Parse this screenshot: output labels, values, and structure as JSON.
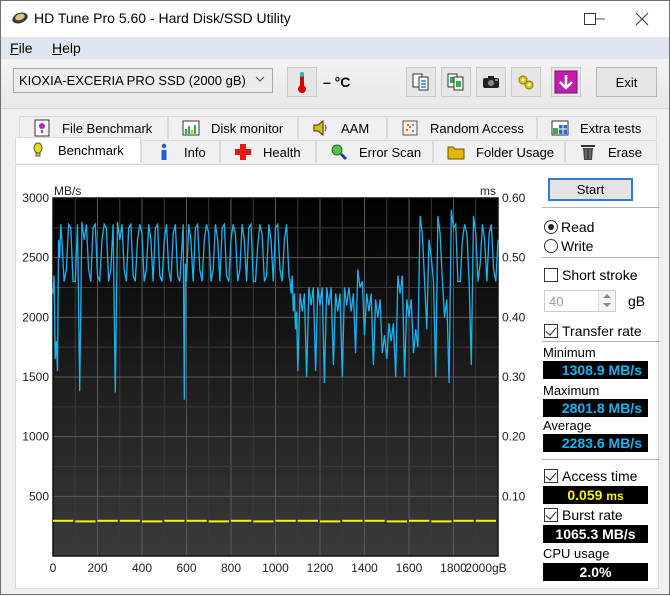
{
  "window": {
    "title": "HD Tune Pro 5.60 - Hard Disk/SSD Utility",
    "controls": [
      "minimize",
      "maximize",
      "close"
    ]
  },
  "menu": {
    "items": [
      {
        "label": "File",
        "accel": "F",
        "rest": "ile"
      },
      {
        "label": "Help",
        "accel": "H",
        "rest": "elp"
      }
    ]
  },
  "toolbar": {
    "drive": "KIOXIA-EXCERIA PRO SSD (2000 gB)",
    "temperature": "– °C",
    "icons": [
      "copy-text-icon",
      "copy-screenshot-icon",
      "camera-icon",
      "options-icon",
      "save-download-icon"
    ],
    "exit_label": "Exit"
  },
  "tabs": {
    "row1": [
      {
        "label": "File Benchmark",
        "icon": "file-benchmark-icon"
      },
      {
        "label": "Disk monitor",
        "icon": "disk-monitor-icon"
      },
      {
        "label": "AAM",
        "icon": "speaker-icon"
      },
      {
        "label": "Random Access",
        "icon": "random-access-icon"
      },
      {
        "label": "Extra tests",
        "icon": "extra-tests-icon"
      }
    ],
    "row2": [
      {
        "label": "Benchmark",
        "icon": "benchmark-icon",
        "active": true
      },
      {
        "label": "Info",
        "icon": "info-icon"
      },
      {
        "label": "Health",
        "icon": "health-icon"
      },
      {
        "label": "Error Scan",
        "icon": "error-scan-icon"
      },
      {
        "label": "Folder Usage",
        "icon": "folder-icon"
      },
      {
        "label": "Erase",
        "icon": "trash-icon"
      }
    ]
  },
  "side": {
    "start_label": "Start",
    "mode": {
      "read_label": "Read",
      "write_label": "Write",
      "selected": "read"
    },
    "short_stroke": {
      "label": "Short stroke",
      "checked": false,
      "value": "40",
      "unit": "gB"
    },
    "transfer_rate": {
      "label": "Transfer rate",
      "checked": true
    },
    "minimum": {
      "label": "Minimum",
      "value": "1308.9 MB/s"
    },
    "maximum": {
      "label": "Maximum",
      "value": "2801.8 MB/s"
    },
    "average": {
      "label": "Average",
      "value": "2283.6 MB/s"
    },
    "access_time": {
      "label": "Access time",
      "checked": true,
      "value": "0.059",
      "unit": "ms"
    },
    "burst_rate": {
      "label": "Burst rate",
      "checked": true,
      "value": "1065.3 MB/s"
    },
    "cpu": {
      "label": "CPU usage",
      "value": "2.0%"
    }
  },
  "chart_data": {
    "type": "line",
    "title": "",
    "xlabel": "gB",
    "ylabel": "MB/s",
    "y2label": "ms",
    "xlim": [
      0,
      2000
    ],
    "ylim": [
      0,
      3000
    ],
    "y2lim": [
      0,
      0.6
    ],
    "x_ticks": [
      "0",
      "200",
      "400",
      "600",
      "800",
      "1000",
      "1200",
      "1400",
      "1600",
      "1800",
      "2000gB"
    ],
    "y_ticks": [
      "500",
      "1000",
      "1500",
      "2000",
      "2500",
      "3000"
    ],
    "y2_ticks": [
      "0.10",
      "0.20",
      "0.30",
      "0.40",
      "0.50",
      "0.60"
    ],
    "grid": true,
    "series": [
      {
        "name": "Transfer rate",
        "color": "#1ab3f0",
        "axis": "left",
        "x": [
          0,
          10,
          20,
          30,
          40,
          60,
          80,
          100,
          120,
          140,
          160,
          180,
          200,
          220,
          240,
          260,
          280,
          300,
          320,
          340,
          360,
          380,
          400,
          420,
          440,
          460,
          480,
          500,
          520,
          540,
          560,
          580,
          590,
          600,
          620,
          640,
          660,
          680,
          700,
          720,
          740,
          760,
          780,
          800,
          820,
          840,
          860,
          880,
          900,
          920,
          940,
          960,
          980,
          1000,
          1020,
          1040,
          1060,
          1070,
          1080,
          1090,
          1100,
          1120,
          1140,
          1160,
          1180,
          1200,
          1220,
          1240,
          1260,
          1280,
          1300,
          1320,
          1340,
          1360,
          1380,
          1400,
          1420,
          1440,
          1460,
          1480,
          1500,
          1520,
          1540,
          1560,
          1580,
          1600,
          1620,
          1640,
          1660,
          1680,
          1700,
          1720,
          1740,
          1760,
          1780,
          1800,
          1820,
          1840,
          1860,
          1880,
          1900,
          1920,
          1940,
          1960,
          1980,
          2000
        ],
        "y": [
          2200,
          1650,
          1550,
          2500,
          2650,
          2400,
          2750,
          2300,
          1380,
          2650,
          2400,
          2750,
          2350,
          2650,
          2750,
          2400,
          1370,
          2650,
          2400,
          2750,
          2350,
          2650,
          2700,
          2400,
          2650,
          2750,
          2350,
          2650,
          2400,
          2700,
          2350,
          2600,
          1310,
          2300,
          2650,
          2750,
          2400,
          2650,
          2700,
          2400,
          2650,
          2750,
          2350,
          2650,
          2700,
          2400,
          2650,
          2750,
          2300,
          2600,
          2700,
          2350,
          2650,
          2750,
          2400,
          2650,
          2350,
          2200,
          2050,
          1900,
          1550,
          2050,
          1500,
          2100,
          1550,
          2100,
          1450,
          2100,
          1600,
          2050,
          1500,
          2100,
          2050,
          1700,
          2250,
          1850,
          2050,
          1600,
          2000,
          1700,
          1650,
          1800,
          1500,
          2200,
          1500,
          2000,
          1700,
          1750,
          2700,
          1900,
          2500,
          1500,
          2700,
          2000,
          1450,
          2750,
          2300,
          2650,
          2700,
          1600,
          2700,
          2450,
          2650,
          2700,
          2400,
          2650
        ]
      },
      {
        "name": "Access time",
        "color": "#f7f700",
        "axis": "right",
        "type": "scatter",
        "x": [
          0,
          100,
          200,
          300,
          400,
          500,
          600,
          700,
          800,
          900,
          1000,
          1100,
          1200,
          1300,
          1400,
          1500,
          1600,
          1700,
          1800,
          1900
        ],
        "y": [
          0.059,
          0.058,
          0.059,
          0.059,
          0.058,
          0.059,
          0.059,
          0.058,
          0.059,
          0.058,
          0.059,
          0.059,
          0.058,
          0.059,
          0.059,
          0.058,
          0.059,
          0.058,
          0.059,
          0.059
        ]
      }
    ]
  }
}
